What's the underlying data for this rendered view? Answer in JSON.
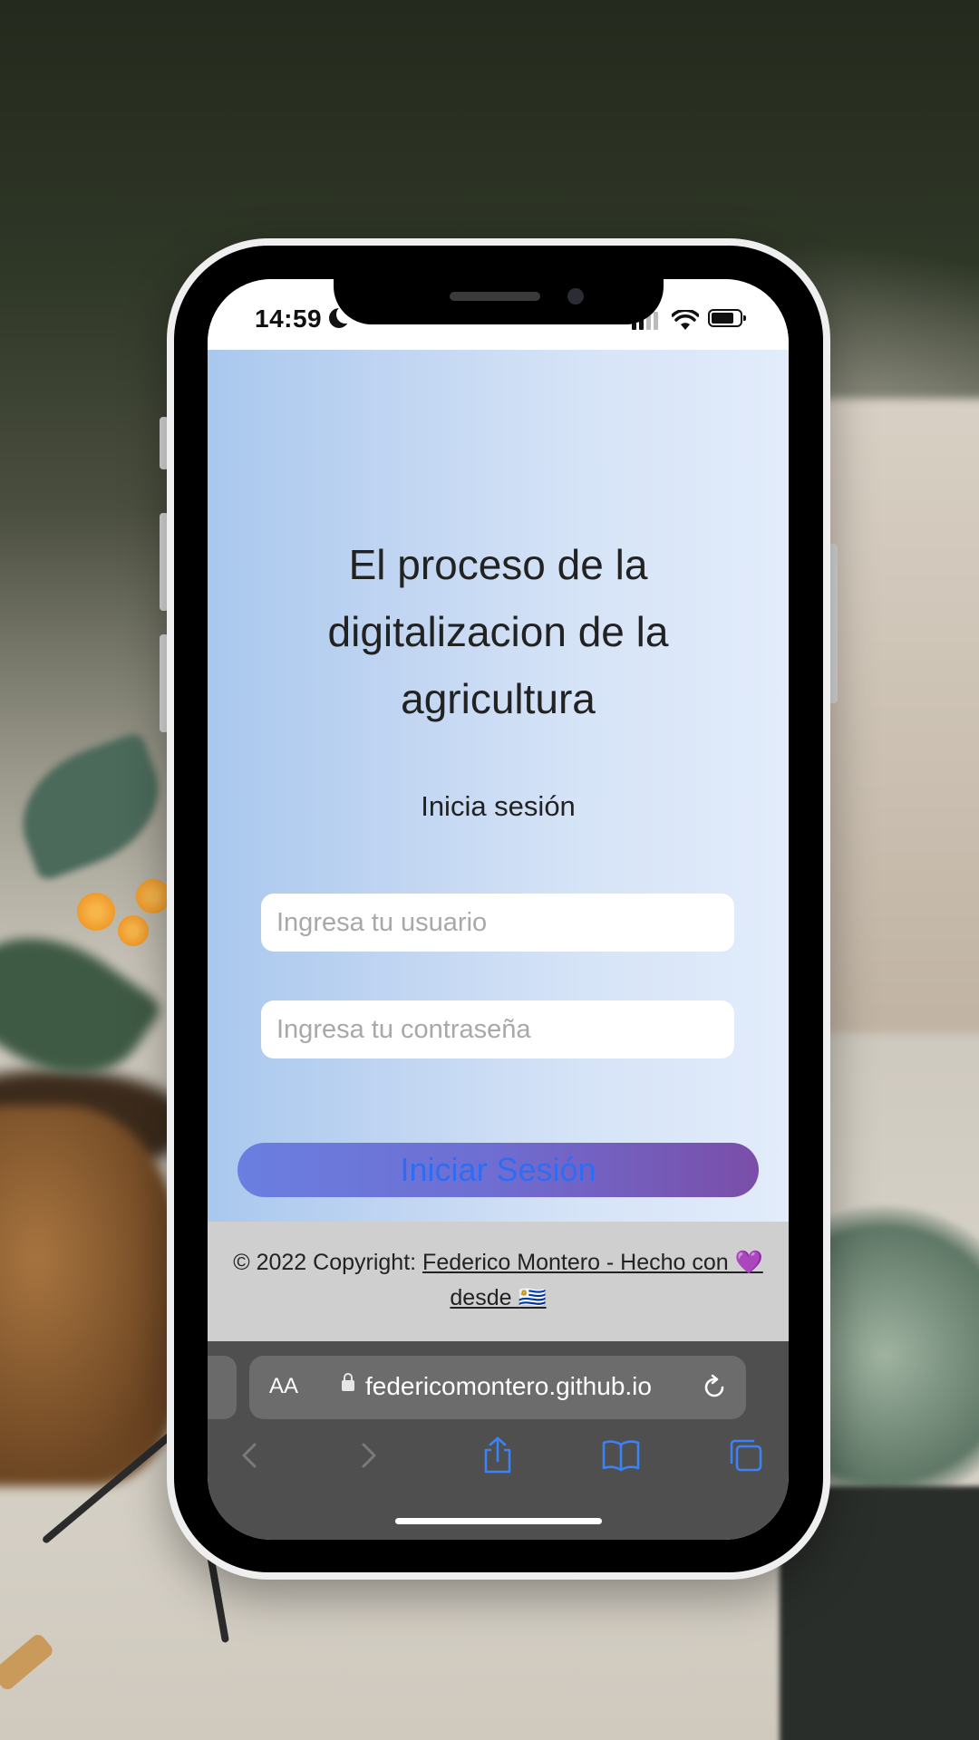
{
  "status_bar": {
    "time": "14:59"
  },
  "page": {
    "headline": "El proceso de la digitalizacion de la agricultura",
    "subheading": "Inicia sesión",
    "username_placeholder": "Ingresa tu usuario",
    "password_placeholder": "Ingresa tu contraseña",
    "login_button": "Iniciar Sesión"
  },
  "footer": {
    "copyright": "© 2022 Copyright: ",
    "author_link": "Federico Montero - Hecho con 💜 desde 🇺🇾"
  },
  "browser": {
    "text_size_label": "AA",
    "url": "federicomontero.github.io",
    "toolbar": [
      "back-icon",
      "forward-icon",
      "share-icon",
      "bookmarks-icon",
      "tabs-icon"
    ]
  },
  "colors": {
    "button_text": "#2f6cf2",
    "toolbar_icon": "#3b82f6",
    "footer_bg": "#cfcfcf"
  }
}
